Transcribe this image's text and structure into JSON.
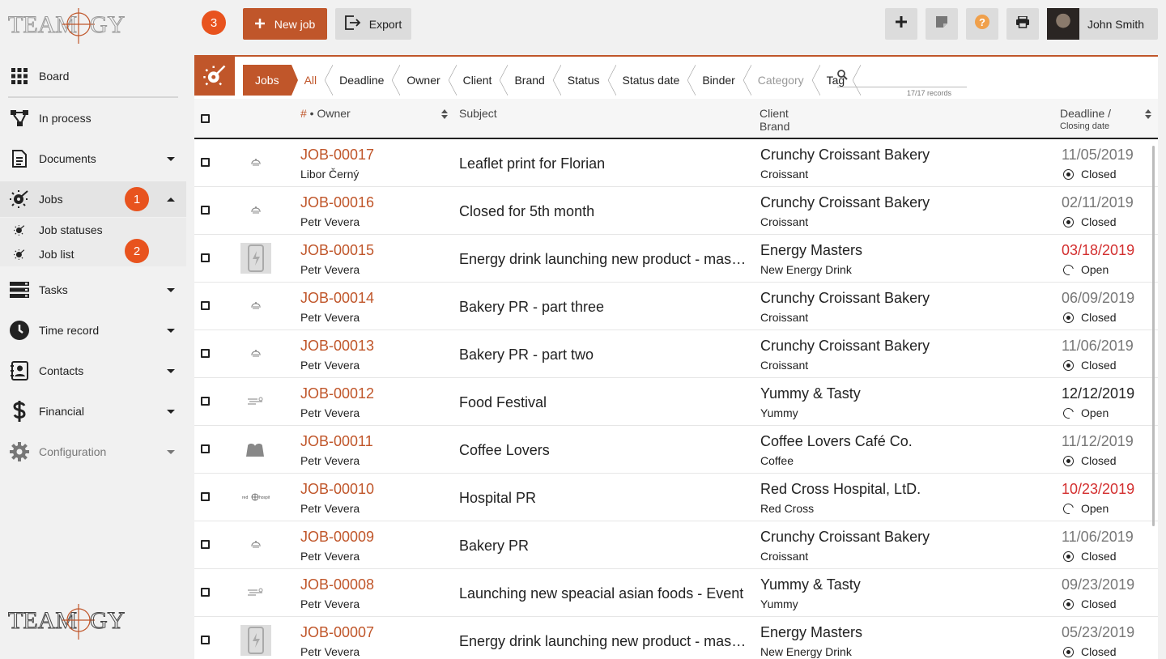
{
  "brand": {
    "logo_text": "TEAMOGY",
    "accent_color": "#c0562a",
    "badge_color": "#e8531e"
  },
  "sidebar": {
    "items": [
      {
        "label": "Board",
        "icon": "grid-icon"
      },
      {
        "label": "In process",
        "icon": "flow-icon"
      },
      {
        "label": "Documents",
        "icon": "document-icon"
      },
      {
        "label": "Jobs",
        "icon": "rocket-icon"
      },
      {
        "label": "Tasks",
        "icon": "tasks-icon"
      },
      {
        "label": "Time record",
        "icon": "clock-icon"
      },
      {
        "label": "Contacts",
        "icon": "contacts-icon"
      },
      {
        "label": "Financial",
        "icon": "dollar-icon"
      },
      {
        "label": "Configuration",
        "icon": "gear-icon"
      }
    ],
    "jobs_sub": [
      {
        "label": "Job statuses"
      },
      {
        "label": "Job list"
      }
    ],
    "badges": [
      "1",
      "2",
      "3"
    ]
  },
  "toolbar": {
    "new_job_label": "New job",
    "export_label": "Export",
    "user_name": "John Smith"
  },
  "filters": {
    "jobs_label": "Jobs",
    "crumbs": [
      "All",
      "Deadline",
      "Owner",
      "Client",
      "Brand",
      "Status",
      "Status date",
      "Binder",
      "Category",
      "Tag"
    ],
    "search_placeholder": "",
    "records": "17/17 records"
  },
  "table": {
    "headers": {
      "hash": "#",
      "owner": " • Owner",
      "subject": "Subject",
      "client": "Client",
      "brand": "Brand",
      "deadline": "Deadline /",
      "closing": "Closing date"
    },
    "rows": [
      {
        "job": "JOB-00017",
        "owner": "Libor Černý",
        "subject": "Leaflet print for Florian",
        "client": "Crunchy Croissant Bakery",
        "brand": "Croissant",
        "date": "11/05/2019",
        "date_style": "grey",
        "status": "Closed",
        "thumb": "bakery"
      },
      {
        "job": "JOB-00016",
        "owner": "Petr Vevera",
        "subject": "Closed for 5th month",
        "client": "Crunchy Croissant Bakery",
        "brand": "Croissant",
        "date": "02/11/2019",
        "date_style": "grey",
        "status": "Closed",
        "thumb": "bakery"
      },
      {
        "job": "JOB-00015",
        "owner": "Petr Vevera",
        "subject": "Energy drink launching new product - mass media campaign",
        "client": "Energy Masters",
        "brand": "New Energy Drink",
        "date": "03/18/2019",
        "date_style": "red",
        "status": "Open",
        "thumb": "energy"
      },
      {
        "job": "JOB-00014",
        "owner": "Petr Vevera",
        "subject": "Bakery PR - part three",
        "client": "Crunchy Croissant Bakery",
        "brand": "Croissant",
        "date": "06/09/2019",
        "date_style": "grey",
        "status": "Closed",
        "thumb": "bakery"
      },
      {
        "job": "JOB-00013",
        "owner": "Petr Vevera",
        "subject": "Bakery PR - part two",
        "client": "Crunchy Croissant Bakery",
        "brand": "Croissant",
        "date": "11/06/2019",
        "date_style": "grey",
        "status": "Closed",
        "thumb": "bakery"
      },
      {
        "job": "JOB-00012",
        "owner": "Petr Vevera",
        "subject": "Food Festival",
        "client": "Yummy & Tasty",
        "brand": "Yummy",
        "date": "12/12/2019",
        "date_style": "black",
        "status": "Open",
        "thumb": "yummy"
      },
      {
        "job": "JOB-00011",
        "owner": "Petr Vevera",
        "subject": "Coffee Lovers",
        "client": "Coffee Lovers Café Co.",
        "brand": "Coffee",
        "date": "11/12/2019",
        "date_style": "grey",
        "status": "Closed",
        "thumb": "coffee"
      },
      {
        "job": "JOB-00010",
        "owner": "Petr Vevera",
        "subject": "Hospital PR",
        "client": "Red Cross Hospital, LtD.",
        "brand": "Red Cross",
        "date": "10/23/2019",
        "date_style": "red",
        "status": "Open",
        "thumb": "hospital"
      },
      {
        "job": "JOB-00009",
        "owner": "Petr Vevera",
        "subject": "Bakery PR",
        "client": "Crunchy Croissant Bakery",
        "brand": "Croissant",
        "date": "11/06/2019",
        "date_style": "grey",
        "status": "Closed",
        "thumb": "bakery"
      },
      {
        "job": "JOB-00008",
        "owner": "Petr Vevera",
        "subject": "Launching new speacial asian foods - Event",
        "client": "Yummy & Tasty",
        "brand": "Yummy",
        "date": "09/23/2019",
        "date_style": "grey",
        "status": "Closed",
        "thumb": "yummy"
      },
      {
        "job": "JOB-00007",
        "owner": "Petr Vevera",
        "subject": "Energy drink launching new product - mass media campaign",
        "client": "Energy Masters",
        "brand": "New Energy Drink",
        "date": "05/23/2019",
        "date_style": "grey",
        "status": "Closed",
        "thumb": "energy"
      }
    ]
  }
}
